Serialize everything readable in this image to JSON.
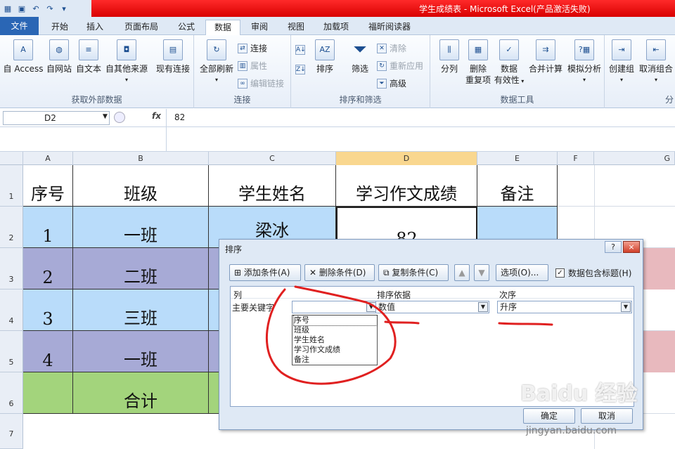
{
  "window": {
    "title": "学生成绩表 - Microsoft Excel(产品激活失败)"
  },
  "tabs": [
    "文件",
    "开始",
    "插入",
    "页面布局",
    "公式",
    "数据",
    "审阅",
    "视图",
    "加载项",
    "福昕阅读器"
  ],
  "ribbon": {
    "g1": {
      "label": "获取外部数据",
      "b1": "自 Access",
      "b2": "自网站",
      "b3": "自文本",
      "b4": "自其他来源",
      "b5": "现有连接"
    },
    "g2": {
      "label": "连接",
      "b1": "全部刷新",
      "s1": "连接",
      "s2": "属性",
      "s3": "编辑链接"
    },
    "g3": {
      "label": "排序和筛选",
      "b1": "排序",
      "b2": "筛选",
      "s1": "清除",
      "s2": "重新应用",
      "s3": "高级"
    },
    "g4": {
      "label": "数据工具",
      "b1": "分列",
      "b2": "删除",
      "b2b": "重复项",
      "b3": "数据",
      "b3b": "有效性",
      "b4": "合并计算",
      "b5": "模拟分析"
    },
    "g5": {
      "b1": "创建组",
      "b2": "取消组合",
      "b3": "分"
    }
  },
  "formula": {
    "cell": "D2",
    "fx": "fx",
    "value": "82"
  },
  "columns": [
    "A",
    "B",
    "C",
    "D",
    "E",
    "F",
    "G"
  ],
  "rows": [
    "1",
    "2",
    "3",
    "4",
    "5",
    "6",
    "7"
  ],
  "sheet": {
    "header": [
      "序号",
      "班级",
      "学生姓名",
      "学习作文成绩",
      "备注"
    ],
    "r2": [
      "1",
      "一班",
      "梁冰",
      "82",
      ""
    ],
    "r3": [
      "2",
      "二班"
    ],
    "r4": [
      "3",
      "三班"
    ],
    "r5": [
      "4",
      "一班"
    ],
    "r6": [
      "合计"
    ]
  },
  "dialog": {
    "title": "排序",
    "help": "?",
    "close": "×",
    "add": "添加条件(A)",
    "del": "删除条件(D)",
    "copy": "复制条件(C)",
    "options": "选项(O)...",
    "hasHeader": "数据包含标题(H)",
    "colHead": "列",
    "basisHead": "排序依据",
    "orderHead": "次序",
    "primary": "主要关键字",
    "basis": "数值",
    "order": "升序",
    "list": [
      "序号",
      "班级",
      "学生姓名",
      "学习作文成绩",
      "备注"
    ],
    "ok": "确定",
    "cancel": "取消"
  },
  "watermark": {
    "text": "Baidu 经验",
    "url": "jingyan.baidu.com"
  },
  "colors": {
    "blue": "#b9dcfa",
    "purple": "#a7aad6",
    "green": "#a3d47c",
    "pink": "#e8b9be",
    "ink": "#e02020"
  }
}
